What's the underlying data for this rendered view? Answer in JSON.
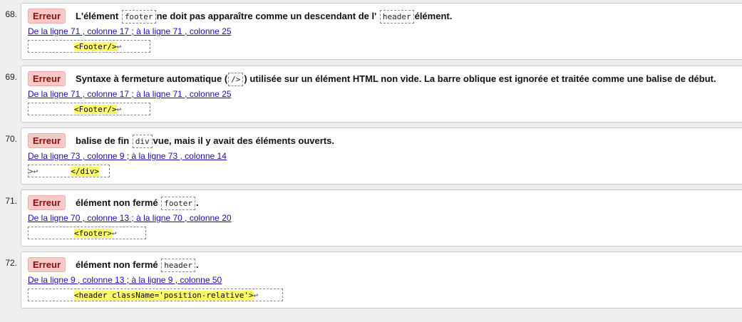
{
  "errors": [
    {
      "number": "68.",
      "badge": "Erreur",
      "msg_a": "L'élément ",
      "code_a": "footer",
      "msg_b": "ne doit pas apparaître comme un descendant de l' ",
      "code_b": "header",
      "msg_c": "élément.",
      "location": "De la ligne 71 , colonne 17 ; à la ligne 71 , colonne 25",
      "extract_pre": "",
      "extract_hl": "<Footer/>",
      "extract_post": "↩"
    },
    {
      "number": "69.",
      "badge": "Erreur",
      "msg_a": "Syntaxe à fermeture automatique (",
      "code_a": "/>",
      "msg_b": ") utilisée sur un élément HTML non vide. La barre oblique est ignorée et traitée comme une balise de début.",
      "location": "De la ligne 71 , colonne 17 ; à la ligne 71 , colonne 25",
      "extract_pre": "",
      "extract_hl": "<Footer/>",
      "extract_post": "↩"
    },
    {
      "number": "70.",
      "badge": "Erreur",
      "msg_a": "balise de fin ",
      "code_a": "div",
      "msg_b": "vue, mais il y avait des éléments ouverts.",
      "location": "De la ligne 73 , colonne 9 ; à la ligne 73 , colonne 14",
      "extract_pre": ">↩",
      "extract_hl": "</div>",
      "extract_post": ""
    },
    {
      "number": "71.",
      "badge": "Erreur",
      "msg_a": "élément non fermé ",
      "code_a": "footer",
      "msg_b": ".",
      "location": "De la ligne 70 , colonne 13 ; à la ligne 70 , colonne 20",
      "extract_pre": "",
      "extract_hl": "<footer>",
      "extract_post": "↩"
    },
    {
      "number": "72.",
      "badge": "Erreur",
      "msg_a": "élément non fermé ",
      "code_a": "header",
      "msg_b": ".",
      "location": "De la ligne 9 , colonne 13 ; à la ligne 9 , colonne 50",
      "extract_pre": "",
      "extract_hl": "<header className='position-relative'>",
      "extract_post": "↩"
    }
  ]
}
